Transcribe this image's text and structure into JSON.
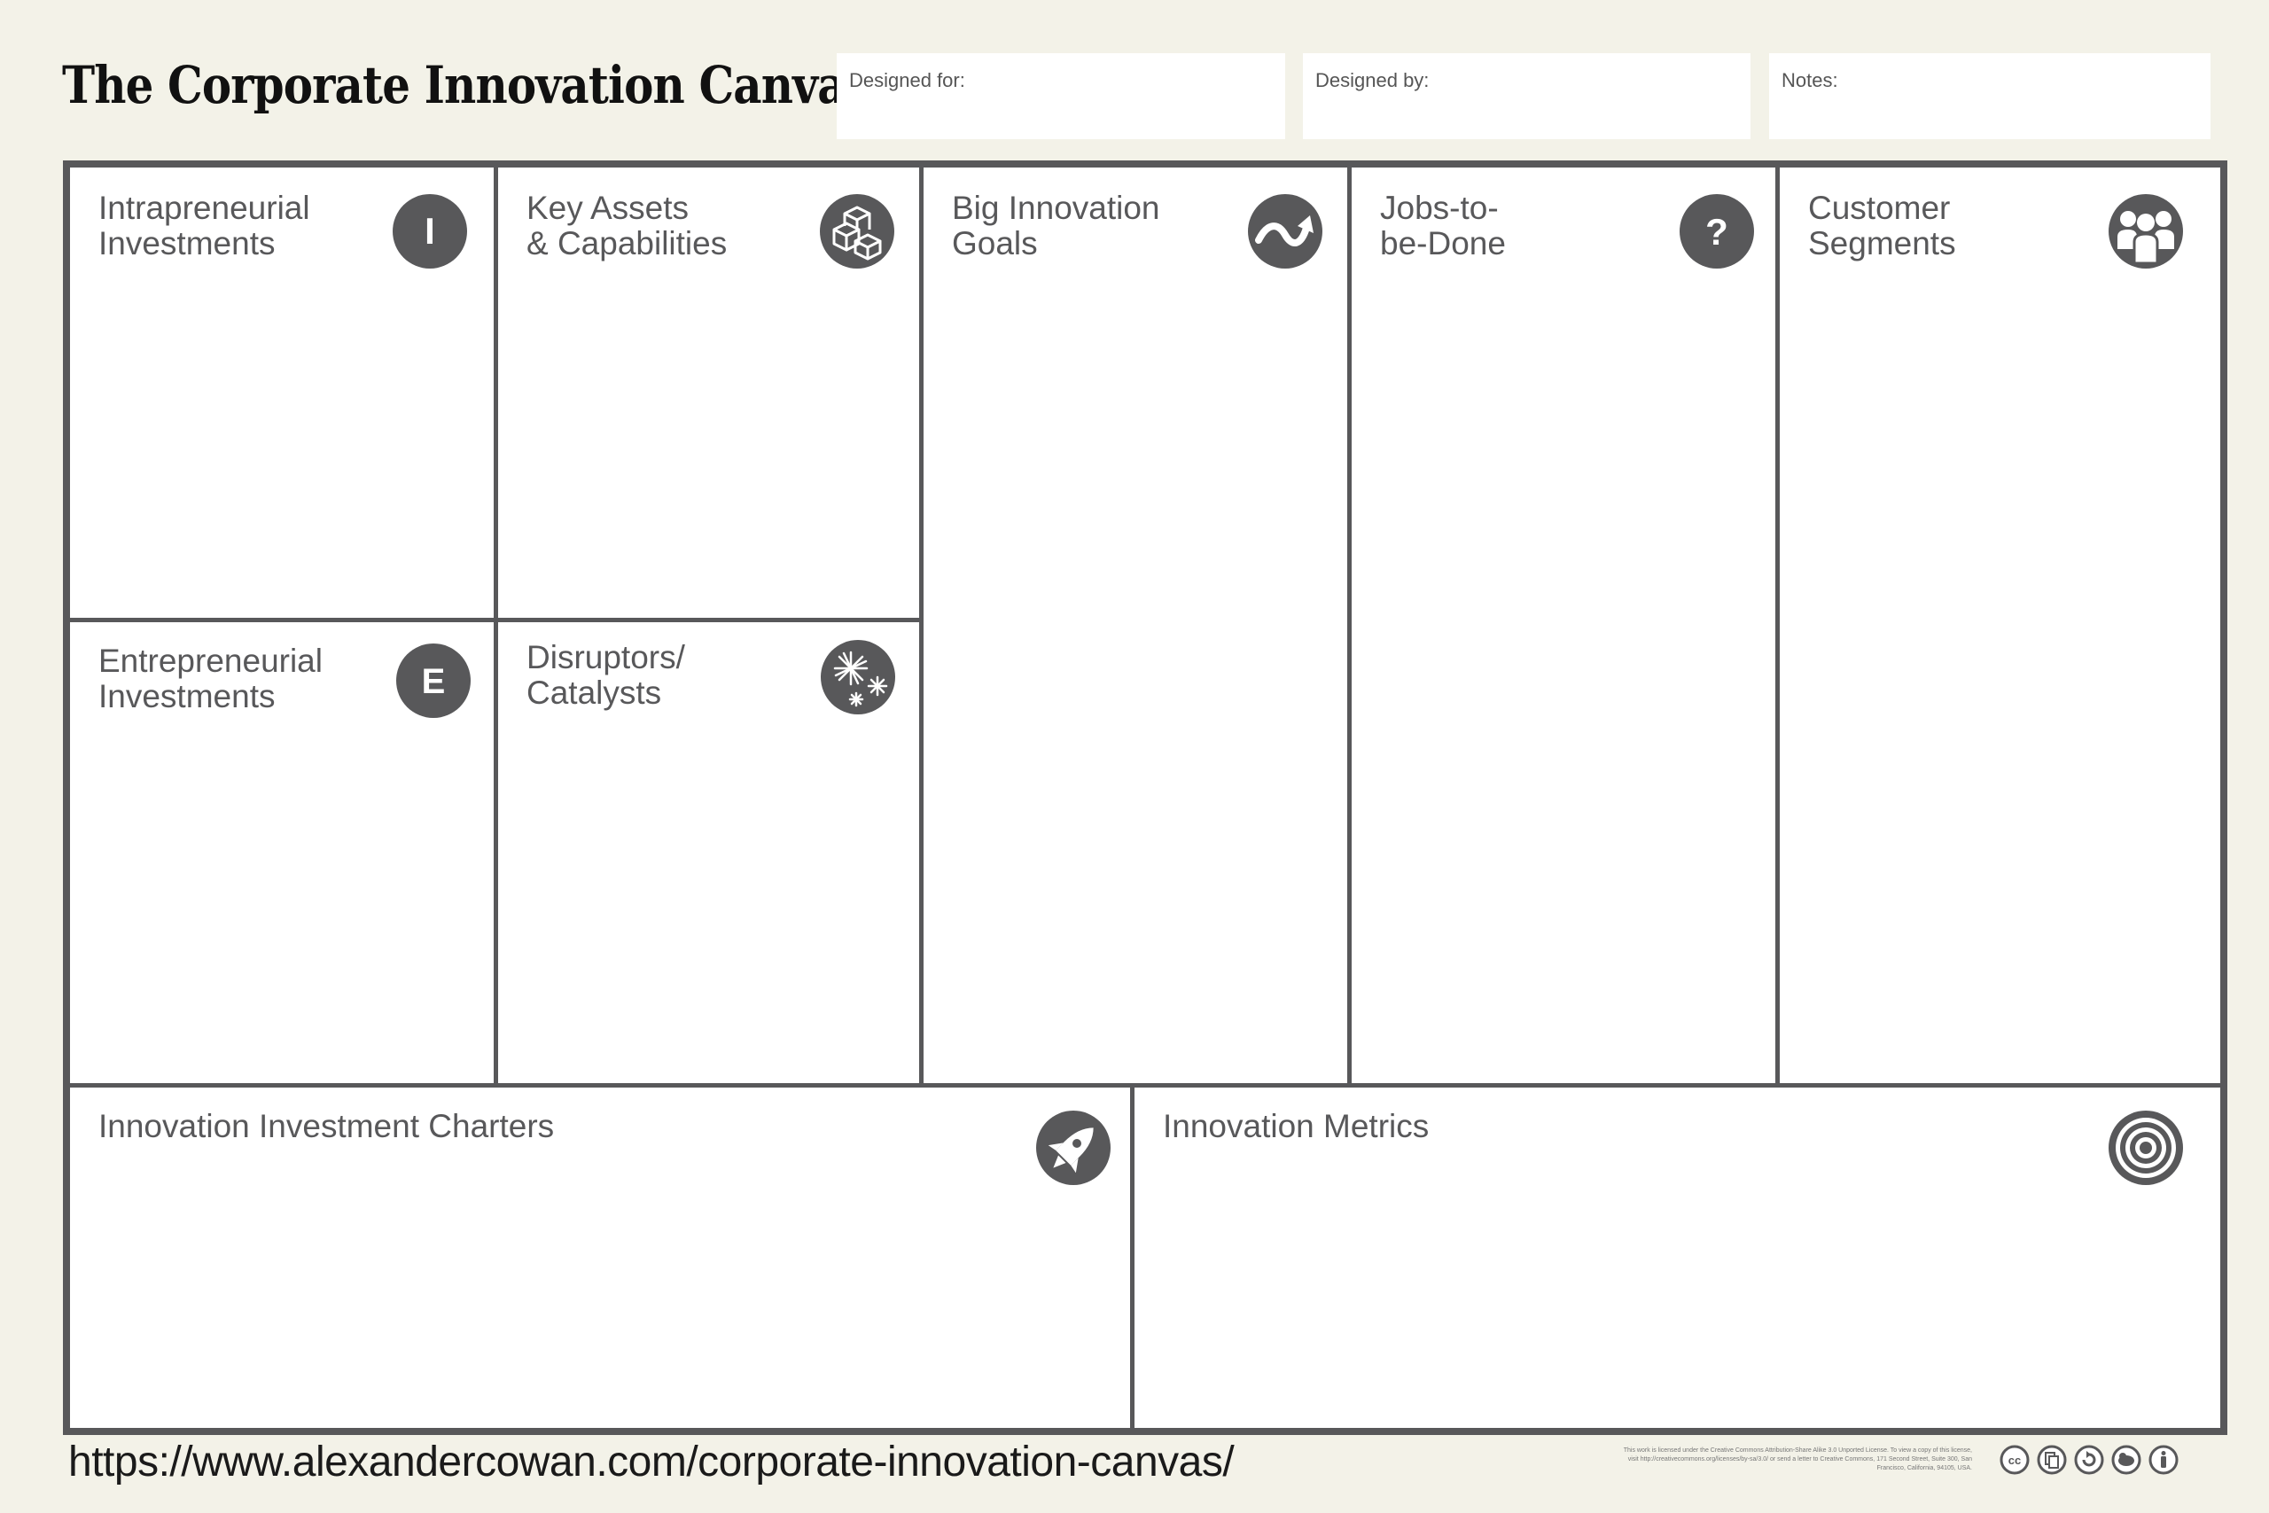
{
  "header": {
    "title": "The Corporate Innovation Canvas",
    "designed_for_label": "Designed for:",
    "designed_by_label": "Designed by:",
    "notes_label": "Notes:"
  },
  "sections": {
    "intrapreneurial_investments": {
      "label": "Intrapreneurial\nInvestments",
      "icon": "intrapreneurial-i-icon",
      "icon_letter": "I"
    },
    "key_assets": {
      "label": "Key Assets\n& Capabilities",
      "icon": "cubes-icon"
    },
    "big_innovation_goals": {
      "label": "Big Innovation\nGoals",
      "icon": "growth-arrow-icon"
    },
    "jobs_to_be_done": {
      "label": "Jobs-to-\nbe-Done",
      "icon": "question-mark-icon",
      "icon_letter": "?"
    },
    "customer_segments": {
      "label": "Customer\nSegments",
      "icon": "people-group-icon"
    },
    "entrepreneurial_investments": {
      "label": "Entrepreneurial\nInvestments",
      "icon": "entrepreneurial-e-icon",
      "icon_letter": "E"
    },
    "disruptors_catalysts": {
      "label": "Disruptors/\nCatalysts",
      "icon": "starburst-icon"
    },
    "innovation_investment_charters": {
      "label": "Innovation Investment Charters",
      "icon": "rocket-icon"
    },
    "innovation_metrics": {
      "label": "Innovation Metrics",
      "icon": "target-icon"
    }
  },
  "footer": {
    "url": "https://www.alexandercowan.com/corporate-innovation-canvas/",
    "license_text": "This work is licensed under the Creative Commons Attribution-Share Alike 3.0 Unported License. To view a copy of this license, visit http://creativecommons.org/licenses/by-sa/3.0/ or send a letter to Creative Commons, 171 Second Street, Suite 300, San Francisco, California, 94105, USA.",
    "license_icons": [
      "cc-icon",
      "copy-icon",
      "share-alike-icon",
      "remix-icon",
      "attribution-icon"
    ]
  },
  "colors": {
    "background": "#f3f2e8",
    "grid": "#58585a",
    "icon_fill": "#58585a",
    "text": "#58585a"
  }
}
